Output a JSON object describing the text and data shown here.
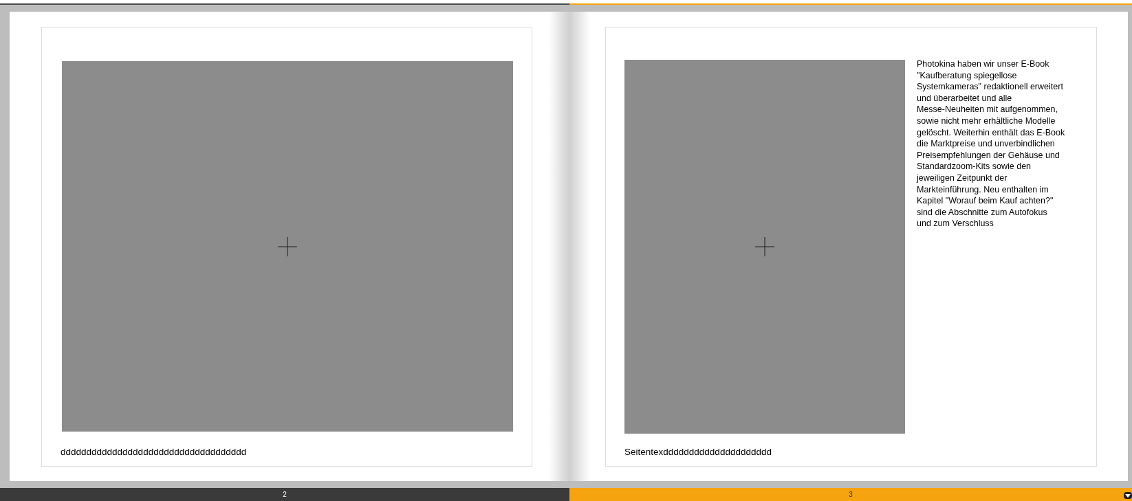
{
  "pages": [
    {
      "number": "2",
      "selected": false,
      "caption": "dddddddddddddddddddddddddddddddddddd"
    },
    {
      "number": "3",
      "selected": true,
      "body": "Photokina haben wir unser E-Book\n\"Kaufberatung spiegellose\nSystemkameras\" redaktionell erweitert\nund überarbeitet und alle\nMesse-Neuheiten mit aufgenommen,\nsowie nicht mehr erhältliche Modelle\ngelöscht. Weiterhin enthält das E-Book\ndie Marktpreise und unverbindlichen\nPreisempfehlungen der Gehäuse und\nStandardzoom-Kits sowie den\njeweiligen Zeitpunkt der\nMarkteinführung. Neu enthalten im\nKapitel \"Worauf beim Kauf achten?\"\nsind die Abschnitte zum Autofokus\nund zum Verschluss",
      "caption": "Seitentexddddddddddddddddddddd"
    }
  ]
}
